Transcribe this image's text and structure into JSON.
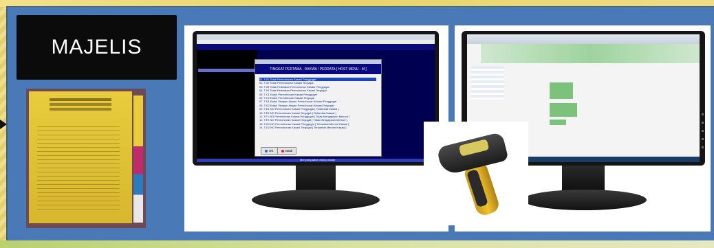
{
  "slide": {
    "title": "MAJELIS",
    "colors": {
      "slide_bg": "#4a79b8",
      "title_bg": "#0b0b0b",
      "border_yellow": "#e9d77a"
    }
  },
  "left_monitor": {
    "dialog_title": "TINGKAT PERTAMA - DAKWA / PERDATA [ HOST MENU - M ]",
    "list_items": [
      "01. T.01 Tidak Permohonan Kasasi Penggugat",
      "02. T.02 Tidak Permohonan Kasasi Tergugat",
      "03. T.03 Tidak Perbaikan Permohonan Kasasi Penggugat",
      "04. T.04 Tidak Perbaikan Permohonan Kasasi Tergugat",
      "05. T.C1 Kabul Permohonan Kasasi Penggugat",
      "06. T.C2 Kabul Permohonan Kasasi Tergugat",
      "07. T.D1 Kabul Tetapan Alasan Permohonan Kasasi Penggugat",
      "08. T.D2 Kabul Tetapan Alasan Permohonan Kasasi Tergugat",
      "09. T.E1 NO Permohonan Kasasi Penggugat [ Terlambat Kasasi ]",
      "10. T.E2 NO Permohonan Kasasi Tergugat [ Terlambat Kasasi ]",
      "11. T.F1 NO Permohonan Kasasi Penggugat [ Tidak Mengajukan Memori ]",
      "12. T.F2 NO Permohonan Kasasi Tergugat [ Tidak Mengajukan Memori ]",
      "13. T.G1 NO Permohonan Kasasi Penggugat [ Terlambat Memori Kasasi ]",
      "14. T.G2 NO Permohonan Kasasi Tergugat [ Terlambat Memori Kasasi ]"
    ],
    "ok_label": "OK",
    "cancel_label": "Batal",
    "status_text": "Menyampaikan data putusan"
  }
}
